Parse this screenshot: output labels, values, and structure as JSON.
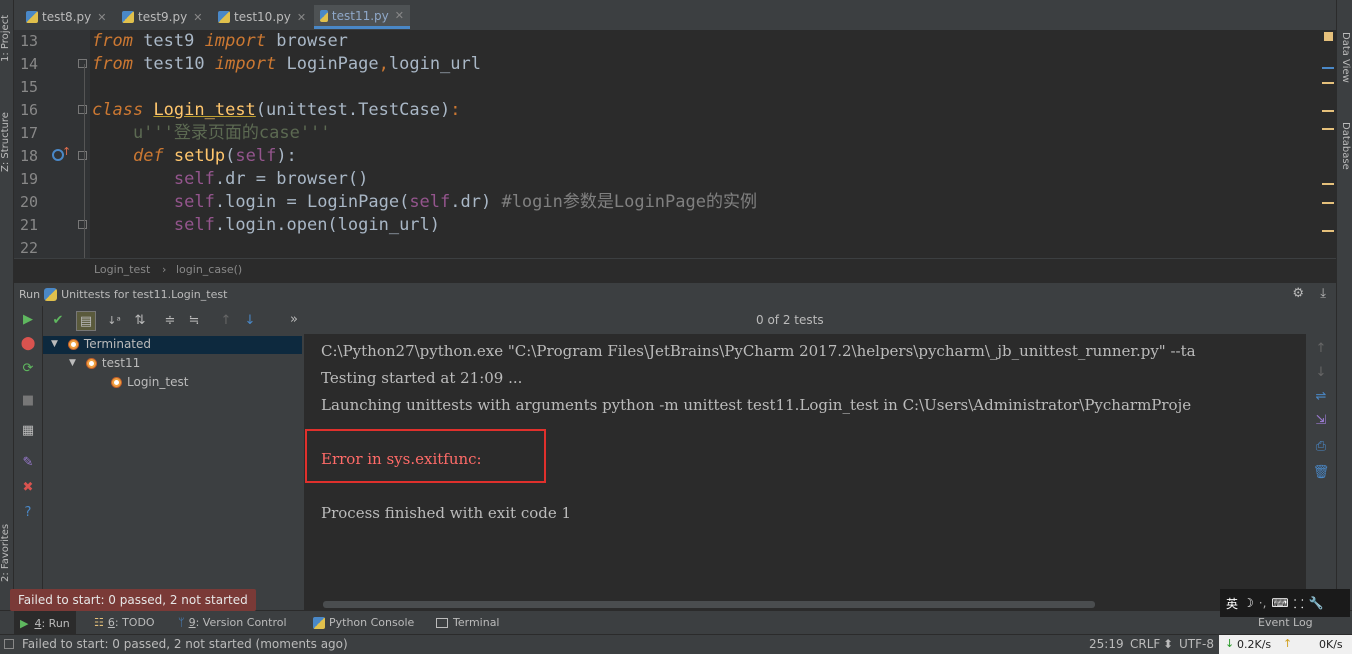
{
  "tabs": [
    {
      "label": "test8.py",
      "active": false
    },
    {
      "label": "test9.py",
      "active": false
    },
    {
      "label": "test10.py",
      "active": false
    },
    {
      "label": "test11.py",
      "active": true
    }
  ],
  "left_strip": {
    "project": "1: Project",
    "structure": "Z: Structure",
    "favorites": "2: Favorites"
  },
  "right_strip": {
    "data_view": "Data View",
    "database": "Database"
  },
  "editor": {
    "lines": [
      {
        "num": "13"
      },
      {
        "num": "14"
      },
      {
        "num": "15"
      },
      {
        "num": "16"
      },
      {
        "num": "17"
      },
      {
        "num": "18"
      },
      {
        "num": "19"
      },
      {
        "num": "20"
      },
      {
        "num": "21"
      },
      {
        "num": "22"
      }
    ],
    "tokens": {
      "l13_a": "from",
      "l13_b": " test9 ",
      "l13_c": "import",
      "l13_d": " browser",
      "l14_a": "from",
      "l14_b": " test10 ",
      "l14_c": "import",
      "l14_d": " LoginPage",
      "l14_e": ",",
      "l14_f": "login_url",
      "l16_a": "class",
      "l16_b": " ",
      "l16_c": "Login_test",
      "l16_d": "(unittest.TestCase)",
      "l16_e": ":",
      "l17_a": "    u'''登录页面的case'''",
      "l18_a": "    ",
      "l18_b": "def",
      "l18_c": " ",
      "l18_d": "setUp",
      "l18_e": "(",
      "l18_f": "self",
      "l18_g": "):",
      "l19_a": "        ",
      "l19_b": "self",
      "l19_c": ".dr = browser()",
      "l20_a": "        ",
      "l20_b": "self",
      "l20_c": ".login = LoginPage(",
      "l20_d": "self",
      "l20_e": ".dr) ",
      "l20_f": "#login参数是LoginPage的实例",
      "l21_a": "        ",
      "l21_b": "self",
      "l21_c": ".login.open(login_url)"
    }
  },
  "breadcrumb": {
    "item1": "Login_test",
    "sep": "›",
    "item2": "login_case()"
  },
  "run_panel": {
    "run_label": "Run",
    "config_name": "Unittests for test11.Login_test",
    "test_count": "0 of 2 tests",
    "tree": [
      {
        "label": "Terminated"
      },
      {
        "label": "test11"
      },
      {
        "label": "Login_test"
      }
    ],
    "console": [
      "C:\\Python27\\python.exe \"C:\\Program Files\\JetBrains\\PyCharm 2017.2\\helpers\\pycharm\\_jb_unittest_runner.py\" --ta",
      "Testing started at 21:09 ...",
      "Launching unittests with arguments python -m unittest test11.Login_test in C:\\Users\\Administrator\\PycharmProje",
      "Error in sys.exitfunc:",
      "Process finished with exit code 1"
    ]
  },
  "tooltip": "Failed to start: 0 passed, 2 not started",
  "bottom_tabs": [
    {
      "key": "4",
      "label": ": Run"
    },
    {
      "key": "6",
      "label": ": TODO"
    },
    {
      "key": "9",
      "label": ": Version Control"
    },
    {
      "key": "",
      "label": "Python Console"
    },
    {
      "key": "",
      "label": "Terminal"
    }
  ],
  "event_log": "Event Log",
  "status": {
    "message": "Failed to start: 0 passed, 2 not started (moments ago)",
    "position": "25:19",
    "line_sep": "CRLF",
    "encoding": "UTF-8",
    "down_speed": "0.2K/s",
    "up_speed": "0K/s"
  },
  "ime": {
    "lang": "英",
    "moon": "☽",
    "dots": "·,",
    "keyboard": "⌨",
    "punct": "⸬",
    "wrench": "🔧"
  }
}
